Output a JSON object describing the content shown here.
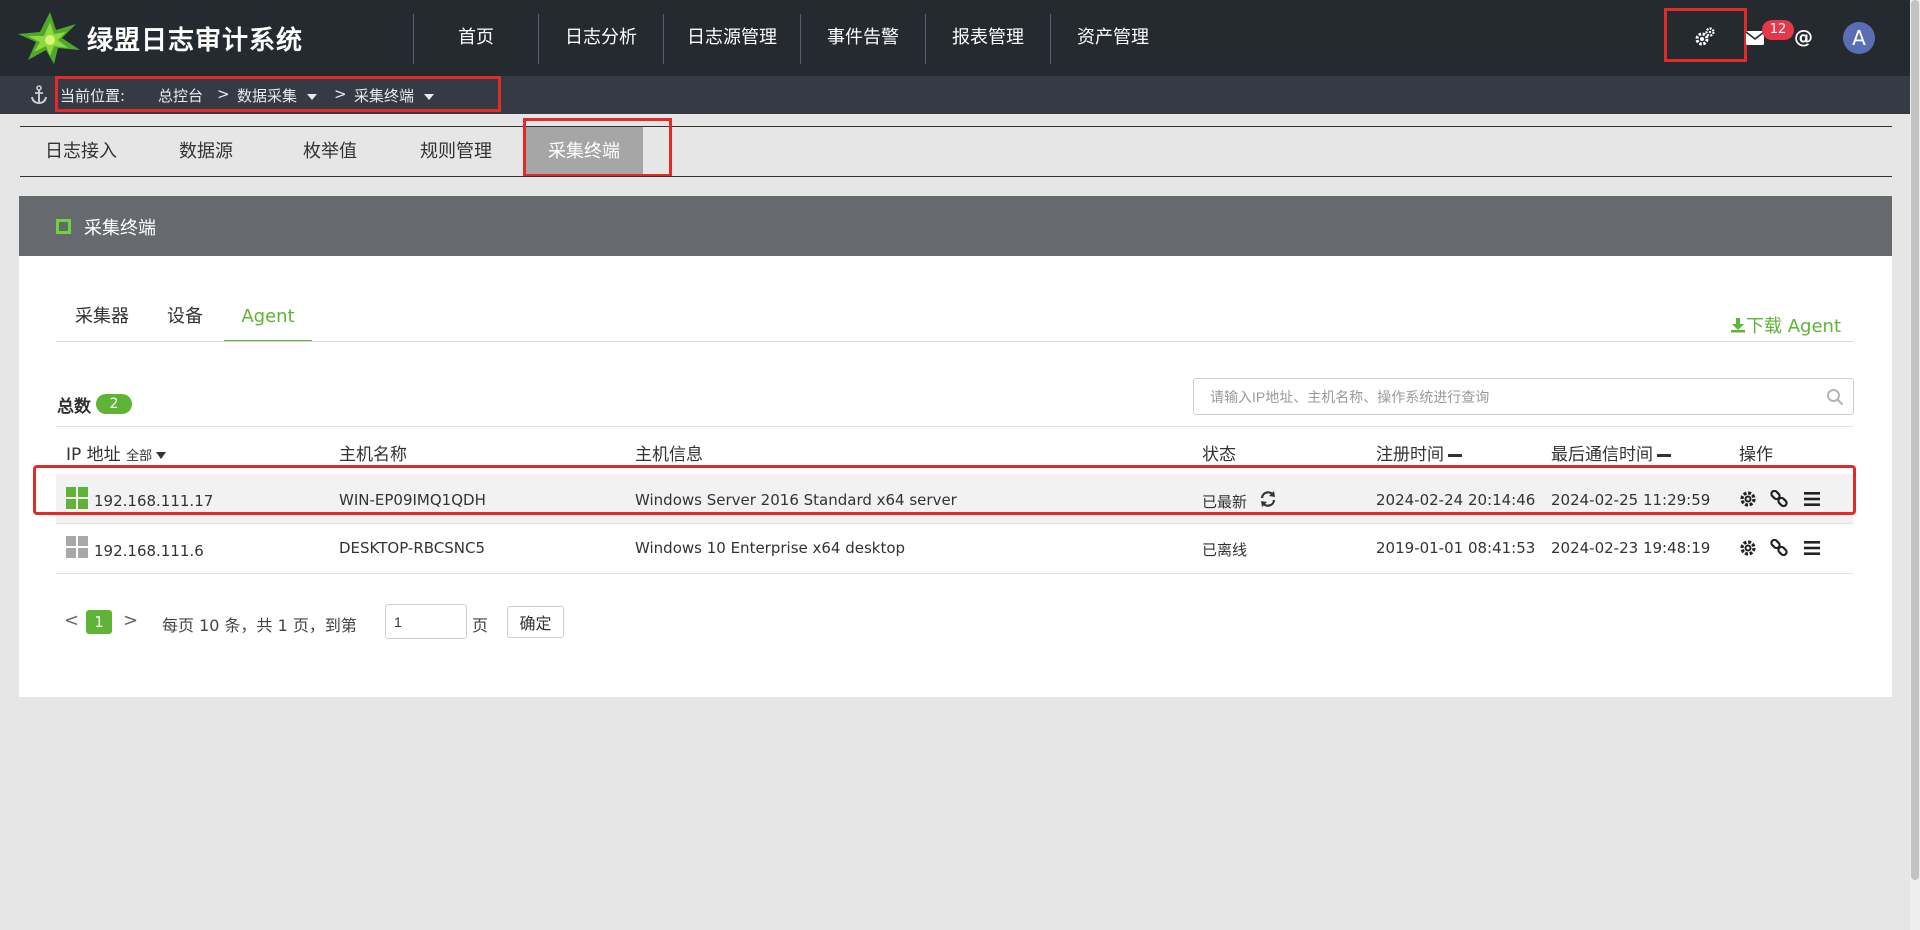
{
  "header": {
    "app_title": "绿盟日志审计系统",
    "nav": [
      "首页",
      "日志分析",
      "日志源管理",
      "事件告警",
      "报表管理",
      "资产管理"
    ],
    "mail_badge": "12",
    "at_label": "@",
    "avatar_letter": "A"
  },
  "breadcrumb": {
    "label": "当前位置:",
    "items": [
      "总控台",
      ">",
      "数据采集",
      ">",
      "采集终端"
    ]
  },
  "module_tabs": [
    "日志接入",
    "数据源",
    "枚举值",
    "规则管理",
    "采集终端"
  ],
  "module_tabs_active": "采集终端",
  "panel": {
    "title": "采集终端",
    "subtabs": [
      "采集器",
      "设备",
      "Agent"
    ],
    "subtabs_active": "Agent",
    "download_label": "下载 Agent",
    "total_label": "总数",
    "total_count": "2",
    "search_placeholder": "请输入IP地址、主机名称、操作系统进行查询"
  },
  "table": {
    "columns": {
      "ip": "IP 地址",
      "ip_filter": "全部",
      "host": "主机名称",
      "info": "主机信息",
      "status": "状态",
      "register_time": "注册时间",
      "last_comm_time": "最后通信时间",
      "actions": "操作"
    },
    "rows": [
      {
        "ip": "192.168.111.17",
        "host": "WIN-EP09IMQ1QDH",
        "info": "Windows Server 2016 Standard x64 server",
        "status": "已最新",
        "register_time": "2024-02-24 20:14:46",
        "last_comm_time": "2024-02-25 11:29:59",
        "os_icon_color": "#5fb337"
      },
      {
        "ip": "192.168.111.6",
        "host": "DESKTOP-RBCSNC5",
        "info": "Windows 10 Enterprise x64 desktop",
        "status": "已离线",
        "register_time": "2019-01-01 08:41:53",
        "last_comm_time": "2024-02-23 19:48:19",
        "os_icon_color": "#a8a8a8"
      }
    ]
  },
  "pagination": {
    "prev": "<",
    "current": "1",
    "next": ">",
    "summary": "每页 10 条，共 1 页，到第",
    "page_input": "1",
    "page_unit": "页",
    "confirm": "确定"
  },
  "colors": {
    "accent": "#5fb337",
    "header_bg": "#252a30",
    "highlight": "#e12a2a"
  },
  "icons": [
    "logo-icon",
    "gear-icon",
    "mail-icon",
    "anchor-icon",
    "download-icon",
    "search-icon",
    "windows-icon",
    "refresh-icon",
    "settings-icon",
    "link-icon",
    "menu-icon"
  ]
}
